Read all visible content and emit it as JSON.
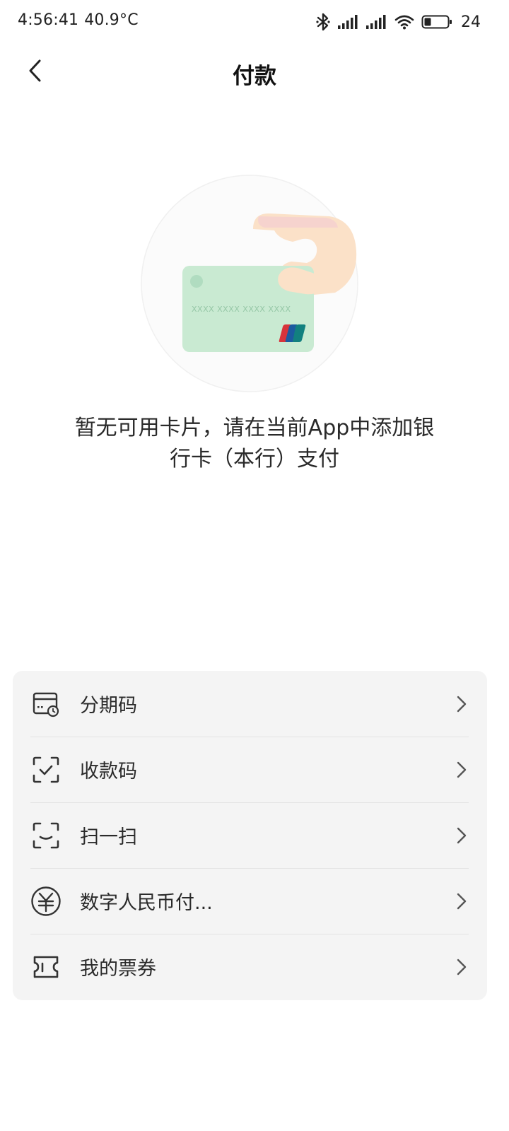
{
  "status_bar": {
    "time": "4:56:41",
    "temperature": "40.9°C",
    "battery_level": "24",
    "icons": [
      "bluetooth-icon",
      "signal-icon",
      "signal-icon",
      "wifi-icon",
      "battery-icon"
    ]
  },
  "header": {
    "title": "付款",
    "back_icon": "chevron-left-icon"
  },
  "empty_state": {
    "illustration_icon": "hand-holding-card-illustration",
    "card_number": "XXXX XXXX XXXX XXXX",
    "message_line1": "暂无可用卡片，请在当前App中添加银",
    "message_line2": "行卡（本行）支付"
  },
  "menu": {
    "items": [
      {
        "label": "分期码",
        "icon": "installment-card-icon"
      },
      {
        "label": "收款码",
        "icon": "receive-scan-icon"
      },
      {
        "label": "扫一扫",
        "icon": "scan-icon"
      },
      {
        "label": "数字人民币付...",
        "icon": "digital-yuan-icon"
      },
      {
        "label": "我的票券",
        "icon": "ticket-icon"
      }
    ]
  },
  "colors": {
    "card_green": "#c9ead2",
    "card_dot": "#b0dcc0",
    "hand_orange": "#fbe1c8",
    "menu_background": "#f4f4f4",
    "unionpay_red": "#d8333b",
    "unionpay_blue": "#1c5aa0",
    "unionpay_green": "#12807f"
  }
}
